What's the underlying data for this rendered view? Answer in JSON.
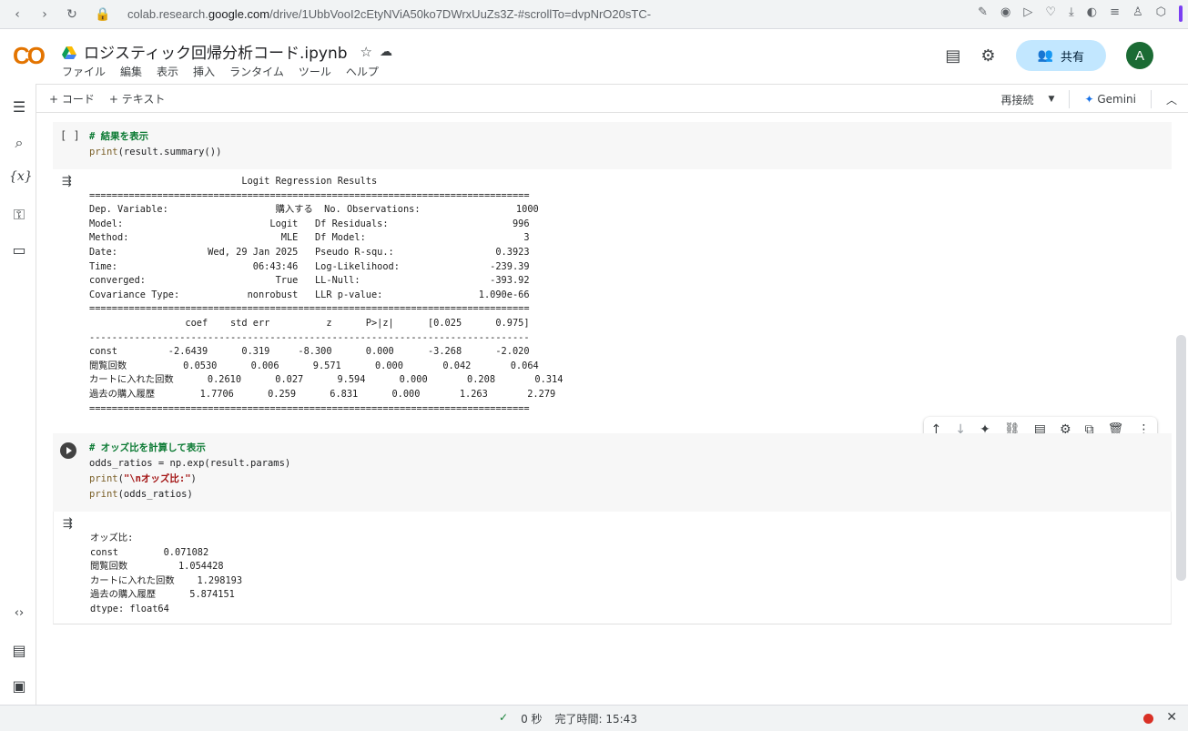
{
  "browser": {
    "url_prefix": "colab.research.",
    "url_domain": "google.com",
    "url_path": "/drive/1UbbVooI2cEtyNViA50ko7DWrxUuZs3Z-#scrollTo=dvpNrO20sTC-"
  },
  "header": {
    "logo": "CO",
    "title": "ロジスティック回帰分析コード.ipynb",
    "menu": [
      "ファイル",
      "編集",
      "表示",
      "挿入",
      "ランタイム",
      "ツール",
      "ヘルプ"
    ],
    "share_label": "共有",
    "avatar_letter": "A"
  },
  "toolbar": {
    "add_code": "+ コード",
    "add_text": "+ テキスト",
    "reconnect": "再接続",
    "gemini": "Gemini"
  },
  "cells": {
    "cell1": {
      "bracket": "[ ]",
      "comment": "# 結果を表示",
      "line2_fn": "print",
      "line2_rest": "(result.summary())",
      "output": "                           Logit Regression Results                           \n==============================================================================\nDep. Variable:                   購入する  No. Observations:                 1000\nModel:                          Logit   Df Residuals:                      996\nMethod:                           MLE   Df Model:                            3\nDate:                Wed, 29 Jan 2025   Pseudo R-squ.:                  0.3923\nTime:                        06:43:46   Log-Likelihood:                -239.39\nconverged:                       True   LL-Null:                       -393.92\nCovariance Type:            nonrobust   LLR p-value:                 1.090e-66\n==============================================================================\n                 coef    std err          z      P>|z|      [0.025      0.975]\n------------------------------------------------------------------------------\nconst         -2.6439      0.319     -8.300      0.000      -3.268      -2.020\n閲覧回数          0.0530      0.006      9.571      0.000       0.042       0.064\nカートに入れた回数      0.2610      0.027      9.594      0.000       0.208       0.314\n過去の購入履歴        1.7706      0.259      6.831      0.000       1.263       2.279\n=============================================================================="
    },
    "cell2": {
      "comment": "# オッズ比を計算して表示",
      "line2": "odds_ratios = np.exp(result.params)",
      "line3_fn": "print",
      "line3_open": "(",
      "line3_str": "\"\\nオッズ比:\"",
      "line3_close": ")",
      "line4_fn": "print",
      "line4_rest": "(odds_ratios)",
      "output": "オッズ比:\nconst        0.071082\n閲覧回数         1.054428\nカートに入れた回数    1.298193\n過去の購入履歴      5.874151\ndtype: float64"
    }
  },
  "status": {
    "check": "✓",
    "elapsed": "0 秒",
    "completed": "完了時間: 15:43"
  }
}
